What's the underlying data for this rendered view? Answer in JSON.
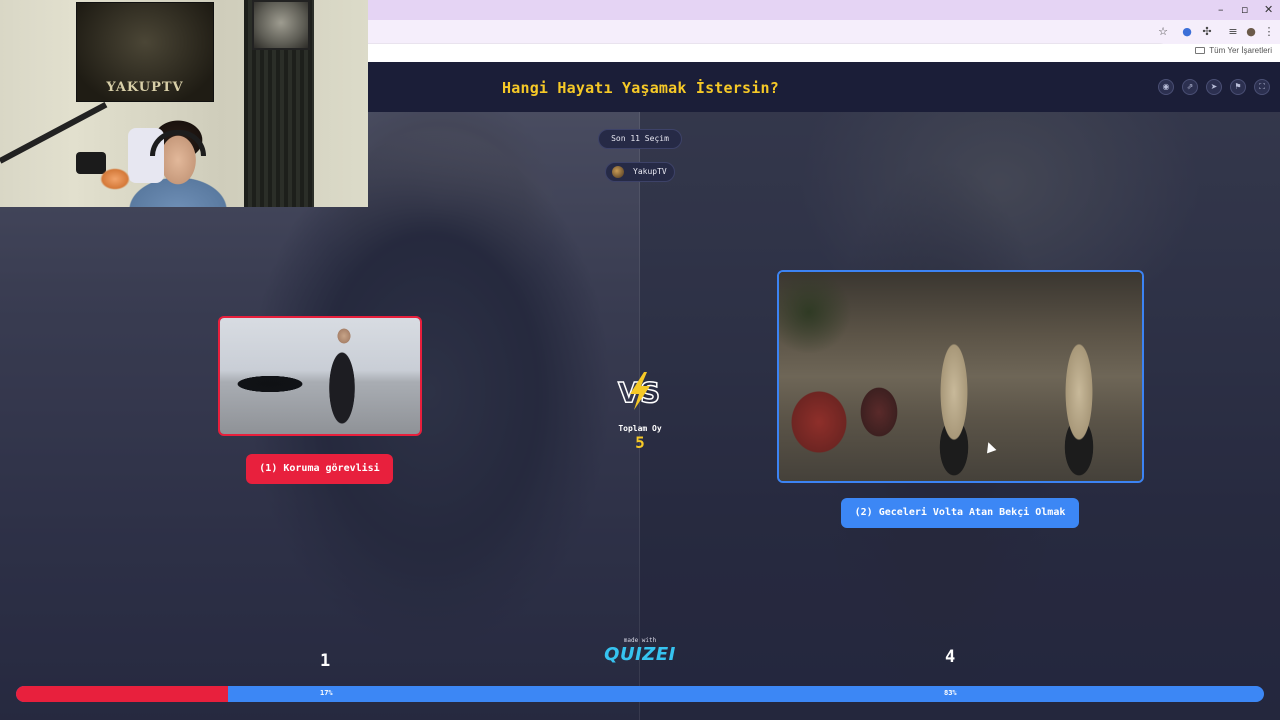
{
  "browser": {
    "window_controls": [
      "–",
      "▫",
      "✕"
    ],
    "toolbar_icons": [
      "star-icon",
      "extension-blue-icon",
      "puzzle-icon",
      "media-icon",
      "profile-icon",
      "menu-dots-icon"
    ],
    "bookmarks_label": "Tüm Yer İşaretleri"
  },
  "header": {
    "title": "Hangi Hayatı Yaşamak İstersin?",
    "icons": [
      "eye-icon",
      "share-icon",
      "send-icon",
      "flag-icon",
      "fullscreen-icon"
    ]
  },
  "badges": {
    "recent_label": "Son 11 Seçim",
    "user_name": "YakupTV"
  },
  "choices": [
    {
      "label": "(1) Koruma görevlisi",
      "votes": "1",
      "percent": "17%",
      "fraction": 0.17,
      "color": "#e8203d"
    },
    {
      "label": "(2) Geceleri Volta Atan Bekçi Olmak",
      "votes": "4",
      "percent": "83%",
      "fraction": 0.83,
      "color": "#3c87f5"
    }
  ],
  "total": {
    "label": "Toplam Oy",
    "value": "5"
  },
  "branding": {
    "made_with": "made with",
    "name": "QUIZEI"
  },
  "webcam": {
    "poster_text": "YAKUPTV"
  },
  "colors": {
    "accent": "#f6c927",
    "red": "#e8203d",
    "blue": "#3c87f5",
    "background": "#1b1e38"
  }
}
